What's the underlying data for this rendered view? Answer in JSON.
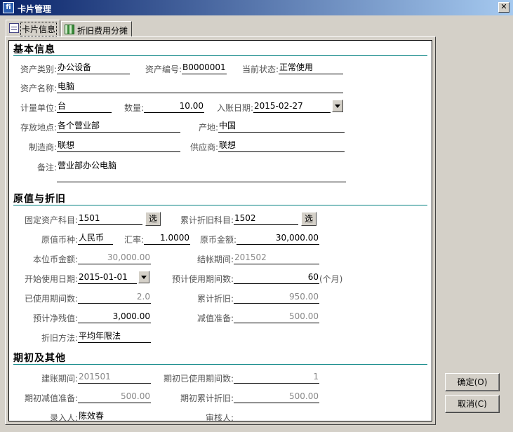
{
  "window": {
    "title": "卡片管理",
    "close_glyph": "✕"
  },
  "tabs": [
    {
      "label": "卡片信息",
      "icon": "card-icon",
      "active": true
    },
    {
      "label": "折旧费用分摊",
      "icon": "depreciation-icon",
      "active": false
    }
  ],
  "basic": {
    "title": "基本信息",
    "asset_type_label": "资产类别:",
    "asset_type": "办公设备",
    "asset_no_label": "资产编号:",
    "asset_no": "B0000001",
    "status_label": "当前状态:",
    "status": "正常使用",
    "asset_name_label": "资产名称:",
    "asset_name": "电脑",
    "unit_label": "计量单位:",
    "unit": "台",
    "qty_label": "数量:",
    "qty": "10.00",
    "entry_date_label": "入账日期:",
    "entry_date": "2015-02-27",
    "location_label": "存放地点:",
    "location": "各个营业部",
    "origin_label": "产地:",
    "origin": "中国",
    "maker_label": "制造商:",
    "maker": "联想",
    "supplier_label": "供应商:",
    "supplier": "联想",
    "remark_label": "备注:",
    "remark": "营业部办公电脑"
  },
  "value": {
    "title": "原值与折旧",
    "fixed_subject_label": "固定资产科目:",
    "fixed_subject": "1501",
    "accum_subject_label": "累计折旧科目:",
    "accum_subject": "1502",
    "select_label": "选",
    "currency_label": "原值币种:",
    "currency": "人民币",
    "rate_label": "汇率:",
    "rate": "1.0000",
    "orig_amount_label": "原币金额:",
    "orig_amount": "30,000.00",
    "local_amount_label": "本位币金额:",
    "local_amount": "30,000.00",
    "close_period_label": "结帐期间:",
    "close_period": "201502",
    "start_date_label": "开始使用日期:",
    "start_date": "2015-01-01",
    "expected_periods_label": "预计使用期间数:",
    "expected_periods": "60",
    "expected_unit": "(个月)",
    "used_periods_label": "已使用期间数:",
    "used_periods": "2.0",
    "accum_dep_label": "累计折旧:",
    "accum_dep": "950.00",
    "residual_label": "预计净残值:",
    "residual": "3,000.00",
    "impairment_label": "减值准备:",
    "impairment": "500.00",
    "method_label": "折旧方法:",
    "method": "平均年限法"
  },
  "initial": {
    "title": "期初及其他",
    "build_period_label": "建账期间:",
    "build_period": "201501",
    "init_used_label": "期初已使用期间数:",
    "init_used": "1",
    "init_impair_label": "期初减值准备:",
    "init_impair": "500.00",
    "init_accum_label": "期初累计折旧:",
    "init_accum": "500.00",
    "entry_person_label": "录入人:",
    "entry_person": "陈效春",
    "reviewer_label": "审核人:",
    "reviewer": ""
  },
  "actions": {
    "ok": "确定(O)",
    "cancel": "取消(C)"
  }
}
